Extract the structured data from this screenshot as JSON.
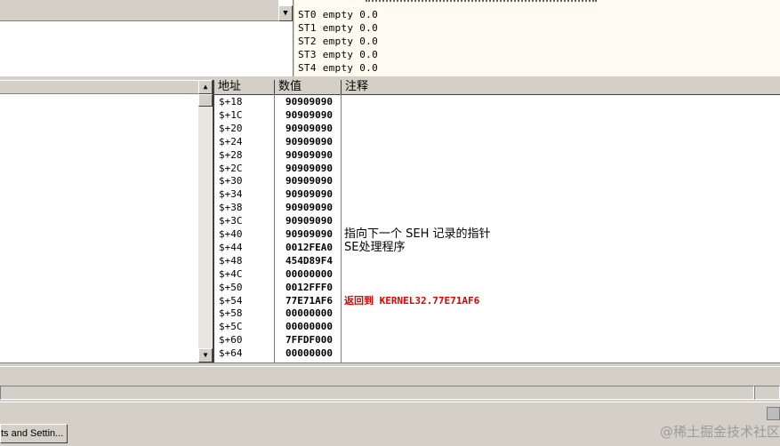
{
  "fpu": {
    "registers": [
      "ST0 empty 0.0",
      "ST1 empty 0.0",
      "ST2 empty 0.0",
      "ST3 empty 0.0",
      "ST4 empty 0.0"
    ]
  },
  "stack": {
    "headers": {
      "address": "地址",
      "value": "数值",
      "comment": "注释"
    },
    "rows": [
      {
        "addr": "$+18",
        "val": "90909090",
        "cmt": ""
      },
      {
        "addr": "$+1C",
        "val": "90909090",
        "cmt": ""
      },
      {
        "addr": "$+20",
        "val": "90909090",
        "cmt": ""
      },
      {
        "addr": "$+24",
        "val": "90909090",
        "cmt": ""
      },
      {
        "addr": "$+28",
        "val": "90909090",
        "cmt": ""
      },
      {
        "addr": "$+2C",
        "val": "90909090",
        "cmt": ""
      },
      {
        "addr": "$+30",
        "val": "90909090",
        "cmt": ""
      },
      {
        "addr": "$+34",
        "val": "90909090",
        "cmt": ""
      },
      {
        "addr": "$+38",
        "val": "90909090",
        "cmt": ""
      },
      {
        "addr": "$+3C",
        "val": "90909090",
        "cmt": ""
      },
      {
        "addr": "$+40",
        "val": "90909090",
        "cmt": "指向下一个 SEH 记录的指针"
      },
      {
        "addr": "$+44",
        "val": "0012FEA0",
        "cmt": "SE处理程序"
      },
      {
        "addr": "$+48",
        "val": "454D89F4",
        "cmt": ""
      },
      {
        "addr": "$+4C",
        "val": "00000000",
        "cmt": ""
      },
      {
        "addr": "$+50",
        "val": "0012FFF0",
        "cmt": ""
      },
      {
        "addr": "$+54",
        "val": "77E71AF6",
        "cmt": "返回到 KERNEL32.77E71AF6",
        "red": true
      },
      {
        "addr": "$+58",
        "val": "00000000",
        "cmt": ""
      },
      {
        "addr": "$+5C",
        "val": "00000000",
        "cmt": ""
      },
      {
        "addr": "$+60",
        "val": "7FFDF000",
        "cmt": ""
      },
      {
        "addr": "$+64",
        "val": "00000000",
        "cmt": ""
      }
    ]
  },
  "taskbar": {
    "button_label": "ts and Settin..."
  },
  "watermark": "@稀土掘金技术社区",
  "scrollbar": {
    "up_arrow": "▲",
    "down_arrow": "▼"
  },
  "dropdown_arrow": "▼",
  "colors": {
    "return_comment": "#e00000"
  }
}
